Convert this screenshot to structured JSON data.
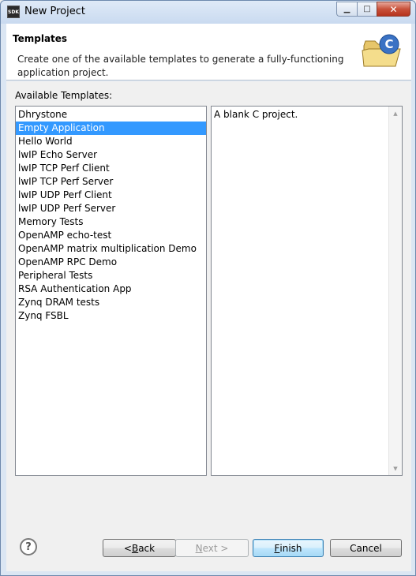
{
  "window": {
    "app_icon_text": "SDK",
    "title": "New Project",
    "minimize_glyph": "▁",
    "maximize_glyph": "□",
    "close_glyph": "✕"
  },
  "banner": {
    "title": "Templates",
    "description": "Create one of the available templates to generate a fully-functioning application project.",
    "icon": "folder-c-project-icon"
  },
  "templates": {
    "label": "Available Templates:",
    "items": [
      "Dhrystone",
      "Empty Application",
      "Hello World",
      "lwIP Echo Server",
      "lwIP TCP Perf Client",
      "lwIP TCP Perf Server",
      "lwIP UDP Perf Client",
      "lwIP UDP Perf Server",
      "Memory Tests",
      "OpenAMP echo-test",
      "OpenAMP matrix multiplication Demo",
      "OpenAMP RPC Demo",
      "Peripheral Tests",
      "RSA Authentication App",
      "Zynq DRAM tests",
      "Zynq FSBL"
    ],
    "selected": "Empty Application"
  },
  "description_panel": {
    "text": "A blank C project."
  },
  "buttons": {
    "help": "?",
    "back_prefix": "< ",
    "back_mnemonic": "B",
    "back_rest": "ack",
    "next_mnemonic": "N",
    "next_rest": "ext >",
    "finish_mnemonic": "F",
    "finish_rest": "inish",
    "cancel": "Cancel"
  },
  "colors": {
    "selection": "#3399ff",
    "window_frame": "#dbe6f3"
  }
}
